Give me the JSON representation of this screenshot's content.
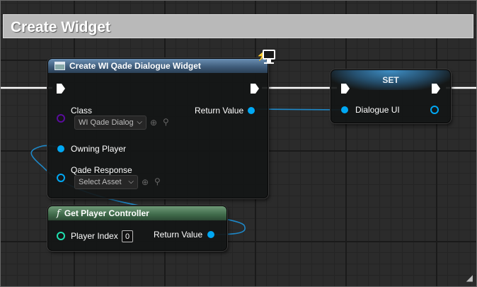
{
  "comment": {
    "title": "Create Widget"
  },
  "create_widget_node": {
    "title": "Create WI Qade Dialogue Widget",
    "class_label": "Class",
    "class_value": "WI Qade Dialog",
    "return_label": "Return Value",
    "owning_player_label": "Owning Player",
    "qade_response_label": "Qade Response",
    "qade_response_value": "Select Asset"
  },
  "set_node": {
    "title": "SET",
    "var_label": "Dialogue UI"
  },
  "get_player_controller_node": {
    "title": "Get Player Controller",
    "function_glyph": "f",
    "player_index_label": "Player Index",
    "player_index_value": "0",
    "return_label": "Return Value"
  },
  "colors": {
    "exec": "#ffffff",
    "object_pin": "#00a8f4",
    "class_pin": "#5a0c9c",
    "int_pin": "#1fe0b0",
    "wire": "#1e88c8"
  },
  "icons": {
    "widget": "monitor-icon",
    "function": "function-icon",
    "dropdown": "chevron-down-icon",
    "browse": "arrow-left-circle-icon",
    "search": "magnifier-icon",
    "resize": "resize-grip-icon"
  }
}
